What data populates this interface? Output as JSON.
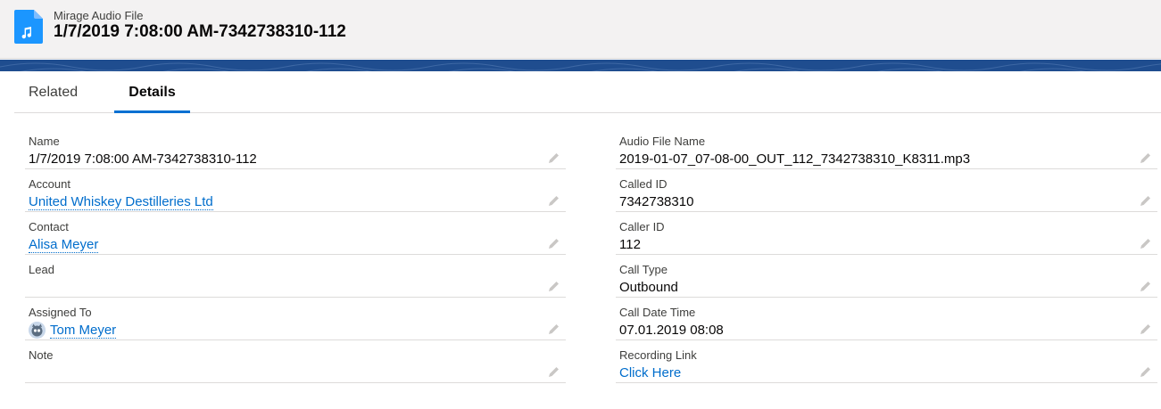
{
  "header": {
    "object_label": "Mirage Audio File",
    "record_title": "1/7/2019 7:08:00 AM-7342738310-112",
    "icon": "audio-file-icon",
    "icon_color": "#1b96ff"
  },
  "tabs": [
    {
      "label": "Related",
      "active": false
    },
    {
      "label": "Details",
      "active": true
    }
  ],
  "colors": {
    "accent": "#0070d2",
    "banner": "#1f4d8f",
    "link": "#006dcc"
  },
  "left_fields": [
    {
      "label": "Name",
      "value": "1/7/2019 7:08:00 AM-7342738310-112"
    },
    {
      "label": "Account",
      "value": "United Whiskey Destilleries Ltd"
    },
    {
      "label": "Contact",
      "value": "Alisa Meyer"
    },
    {
      "label": "Lead",
      "value": ""
    },
    {
      "label": "Assigned To",
      "value": "Tom Meyer"
    },
    {
      "label": "Note",
      "value": ""
    }
  ],
  "right_fields": [
    {
      "label": "Audio File Name",
      "value": "2019-01-07_07-08-00_OUT_112_7342738310_K8311.mp3"
    },
    {
      "label": "Called ID",
      "value": "7342738310"
    },
    {
      "label": "Caller ID",
      "value": "112"
    },
    {
      "label": "Call Type",
      "value": "Outbound"
    },
    {
      "label": "Call Date Time",
      "value": "07.01.2019 08:08"
    },
    {
      "label": "Recording Link",
      "value": "Click Here"
    }
  ]
}
